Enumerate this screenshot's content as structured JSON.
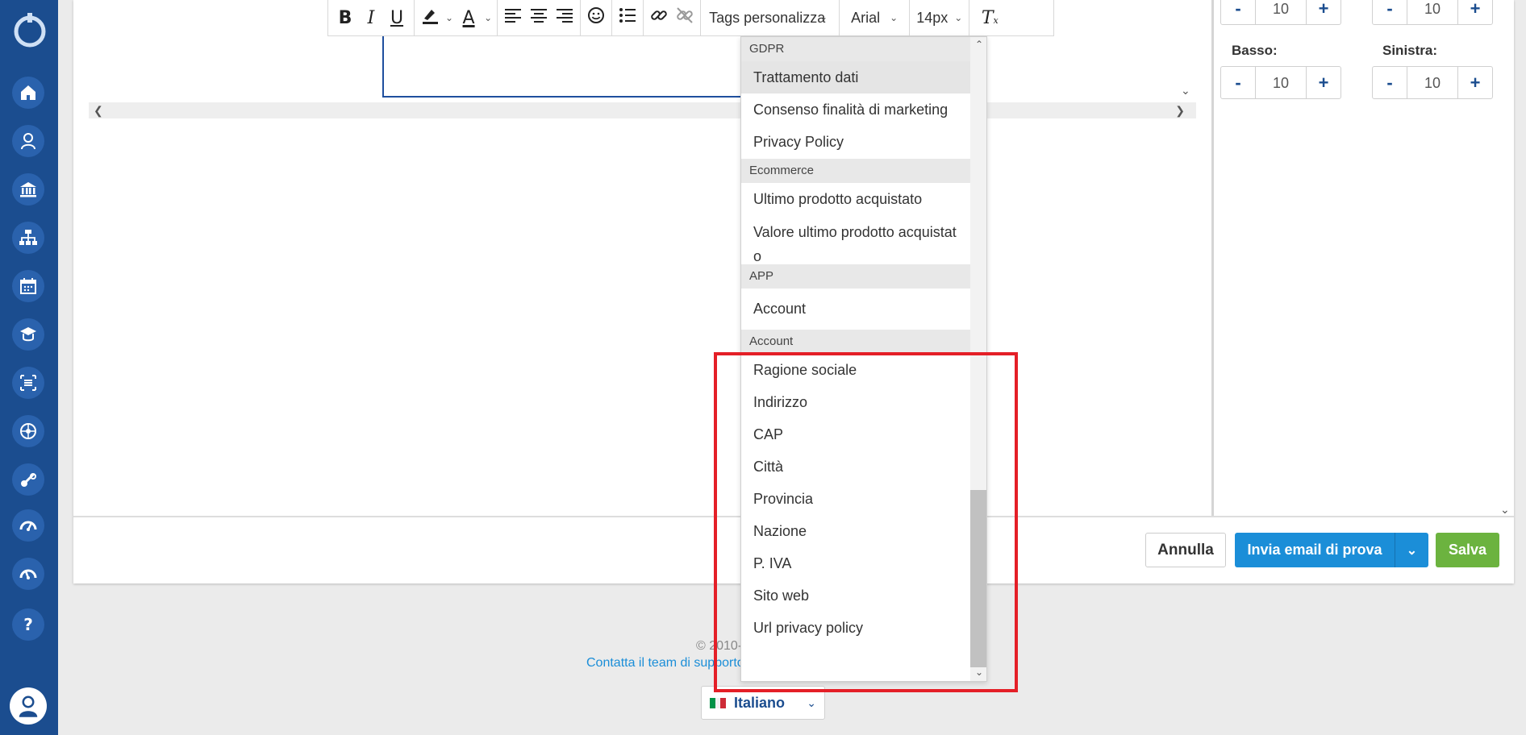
{
  "sidebar": {
    "icons": [
      "home-icon",
      "user-icon",
      "bank-icon",
      "org-chart-icon",
      "calendar-icon",
      "graduation-icon",
      "list-icon",
      "network-icon",
      "tools-icon",
      "gauge-icon",
      "gauge-alt-icon",
      "help-icon"
    ]
  },
  "toolbar": {
    "tags_label": "Tags personalizza",
    "font_family": "Arial",
    "font_size": "14px"
  },
  "dropdown": {
    "groups": [
      {
        "header": "GDPR",
        "items": [
          "Trattamento dati",
          "Consenso finalità di marketing",
          "Privacy Policy"
        ]
      },
      {
        "header": "Ecommerce",
        "items": [
          "Ultimo prodotto acquistato",
          "Valore ultimo prodotto acquistat o"
        ]
      },
      {
        "header": "APP",
        "items": [
          "Account"
        ]
      },
      {
        "header": "Account",
        "items": [
          "Ragione sociale",
          "Indirizzo",
          "CAP",
          "Città",
          "Provincia",
          "Nazione",
          "P. IVA",
          "Sito web",
          "Url privacy policy"
        ]
      }
    ]
  },
  "margins": {
    "top_value": "10",
    "right_value": "10",
    "bottom_label": "Basso:",
    "bottom_value": "10",
    "left_label": "Sinistra:",
    "left_value": "10",
    "minus": "-",
    "plus": "+"
  },
  "actions": {
    "cancel": "Annulla",
    "send_test": "Invia email di prova",
    "save": "Salva"
  },
  "footer": {
    "copyright": "© 2010-",
    "contact": "Contatta il team di supporto",
    "language": "Italiano"
  },
  "colors": {
    "sidebar": "#1b4d8f",
    "primary": "#1b8ed8",
    "success": "#6cb33f",
    "highlight": "#e41f27"
  }
}
